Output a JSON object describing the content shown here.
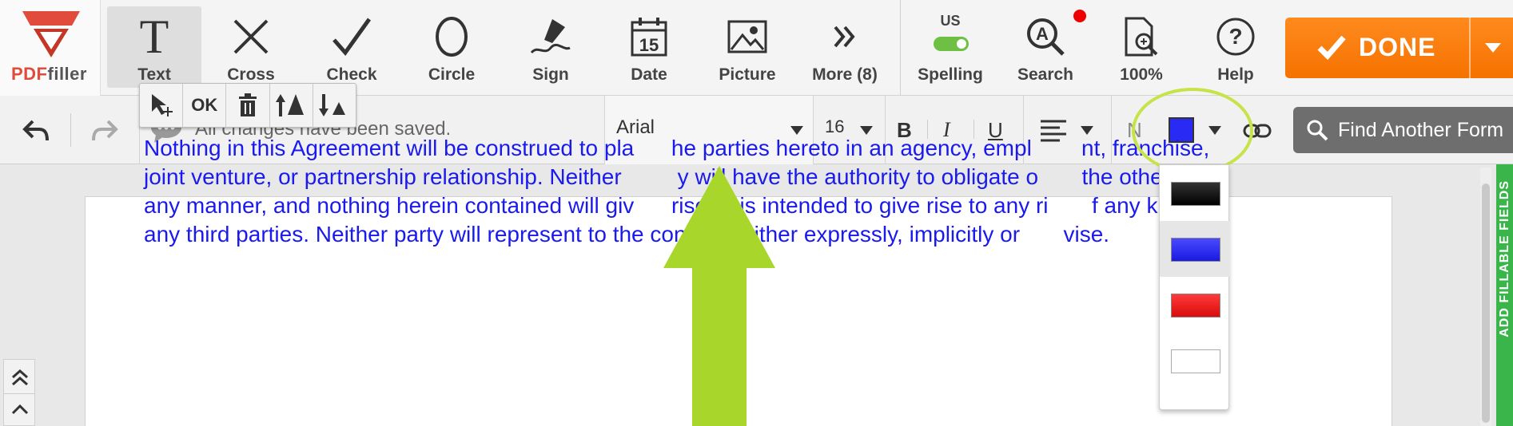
{
  "logo": {
    "brand_pdf": "PDF",
    "brand_filler": "filler"
  },
  "tools": [
    {
      "label": "Text",
      "icon": "text-t-icon"
    },
    {
      "label": "Cross",
      "icon": "cross-icon"
    },
    {
      "label": "Check",
      "icon": "check-icon"
    },
    {
      "label": "Circle",
      "icon": "circle-icon"
    },
    {
      "label": "Sign",
      "icon": "pen-sign-icon"
    },
    {
      "label": "Date",
      "icon": "calendar-icon"
    },
    {
      "label": "Picture",
      "icon": "picture-icon"
    },
    {
      "label": "More (8)",
      "icon": "double-chevron-icon"
    }
  ],
  "date_icon_number": "15",
  "right_tools": {
    "spelling_lang": "US",
    "spelling_label": "Spelling",
    "search_label": "Search",
    "zoom_label": "100%",
    "help_label": "Help"
  },
  "done_label": "DONE",
  "secondbar": {
    "saved_text": "All changes have been saved.",
    "font_value": "Arial",
    "size_value": "16",
    "bold": "B",
    "italic": "I",
    "underline": "U",
    "normal": "N",
    "current_color": "#2a2af5",
    "find_form_label": "Find Another Form"
  },
  "mini_toolbar": {
    "ok_label": "OK"
  },
  "paragraph": [
    "Nothing in this Agreement will be construed to pla      he parties hereto in an agency, empl        nt, franchise,",
    "joint venture, or partnership relationship. Neither         y will have the authority to obligate o       the other in",
    "any manner, and nothing herein contained will giv      rise or is intended to give rise to any ri       f any kind to",
    "any third parties. Neither party will represent to the contrary, either expressly, implicitly or       vise."
  ],
  "color_options": [
    {
      "name": "black",
      "color": "#111111",
      "selected": false
    },
    {
      "name": "blue",
      "color": "#2a2af5",
      "selected": true
    },
    {
      "name": "red",
      "color": "#f01515",
      "selected": false
    },
    {
      "name": "white",
      "color": "#ffffff",
      "selected": false
    }
  ],
  "side_tab_label": "ADD FILLABLE FIELDS",
  "colors": {
    "accent_orange": "#f57200",
    "highlight_green": "#a8d62a",
    "side_tab_green": "#39b54a",
    "text_blue": "#1a1aee"
  }
}
